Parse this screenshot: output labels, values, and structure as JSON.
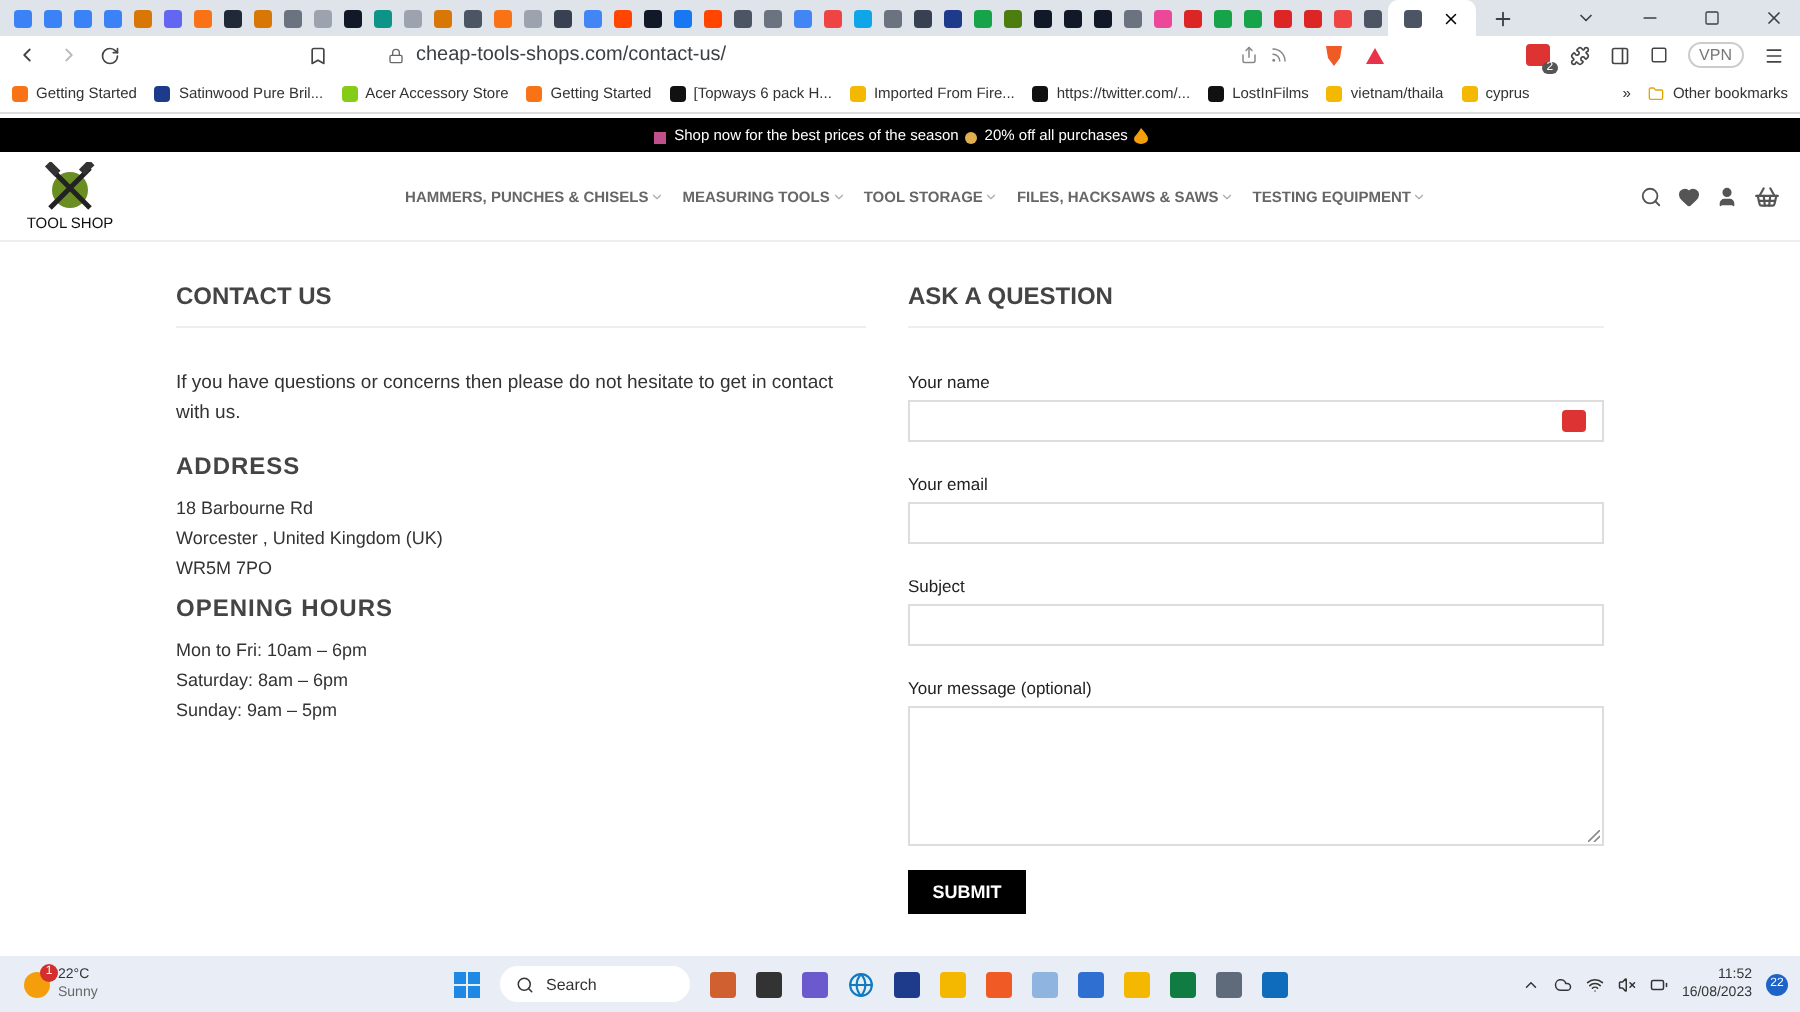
{
  "browser": {
    "tabs": [
      {
        "color": "#3b82f6",
        "selected": false
      },
      {
        "color": "#3b82f6",
        "selected": false
      },
      {
        "color": "#3b82f6",
        "selected": false
      },
      {
        "color": "#3b82f6",
        "selected": false
      },
      {
        "color": "#d97706",
        "selected": false
      },
      {
        "color": "#6366f1",
        "selected": false
      },
      {
        "color": "#f97316",
        "selected": false
      },
      {
        "color": "#1f2937",
        "selected": false
      },
      {
        "color": "#d97706",
        "selected": false
      },
      {
        "color": "#6b7280",
        "selected": false
      },
      {
        "color": "#9ca3af",
        "selected": false
      },
      {
        "color": "#111827",
        "selected": false
      },
      {
        "color": "#0d9488",
        "selected": false
      },
      {
        "color": "#9ca3af",
        "selected": false
      },
      {
        "color": "#d97706",
        "selected": false
      },
      {
        "color": "#4b5563",
        "selected": false
      },
      {
        "color": "#f97316",
        "selected": false
      },
      {
        "color": "#9ca3af",
        "selected": false
      },
      {
        "color": "#374151",
        "selected": false
      },
      {
        "color": "#4285f4",
        "selected": false
      },
      {
        "color": "#ff4500",
        "selected": false
      },
      {
        "color": "#111827",
        "selected": false
      },
      {
        "color": "#1877f2",
        "selected": false
      },
      {
        "color": "#ff4500",
        "selected": false
      },
      {
        "color": "#4b5563",
        "selected": false
      },
      {
        "color": "#6b7280",
        "selected": false
      },
      {
        "color": "#4285f4",
        "selected": false
      },
      {
        "color": "#ef4444",
        "selected": false
      },
      {
        "color": "#0ea5e9",
        "selected": false
      },
      {
        "color": "#6b7280",
        "selected": false
      },
      {
        "color": "#374151",
        "selected": false
      },
      {
        "color": "#1e3a8a",
        "selected": false
      },
      {
        "color": "#16a34a",
        "selected": false
      },
      {
        "color": "#4d7c0f",
        "selected": false
      },
      {
        "color": "#111827",
        "selected": false
      },
      {
        "color": "#111827",
        "selected": false
      },
      {
        "color": "#111827",
        "selected": false
      },
      {
        "color": "#6b7280",
        "selected": false
      },
      {
        "color": "#ec4899",
        "selected": false
      },
      {
        "color": "#dc2626",
        "selected": false
      },
      {
        "color": "#16a34a",
        "selected": false
      },
      {
        "color": "#16a34a",
        "selected": false
      },
      {
        "color": "#dc2626",
        "selected": false
      },
      {
        "color": "#dc2626",
        "selected": false
      },
      {
        "color": "#ef4444",
        "selected": false
      },
      {
        "color": "#4b5563",
        "selected": false
      },
      {
        "color": "#4b5563",
        "selected": true
      }
    ],
    "url": "cheap-tools-shops.com/contact-us/",
    "vpn": "VPN",
    "extension_badge": "2",
    "bookmarks": [
      "Getting Started",
      "Satinwood Pure Bril...",
      "Acer Accessory Store",
      "Getting Started",
      "[Topways 6 pack H...",
      "Imported From Fire...",
      "https://twitter.com/...",
      "LostInFilms",
      "vietnam/thaila",
      "cyprus"
    ],
    "bookmarks_more": "»",
    "other_bookmarks": "Other bookmarks"
  },
  "site": {
    "banner": [
      "Shop now for the best prices of the season",
      "20% off all purchases"
    ],
    "logo": "TOOL SHOP",
    "nav": [
      "HAMMERS, PUNCHES & CHISELS",
      "MEASURING TOOLS",
      "TOOL STORAGE",
      "FILES, HACKSAWS & SAWS",
      "TESTING EQUIPMENT"
    ]
  },
  "contact": {
    "title": "CONTACT US",
    "intro": "If you have questions or concerns then please do not hesitate to get in contact with us.",
    "sections": [
      {
        "heading": "ADDRESS",
        "lines": [
          "18 Barbourne Rd",
          "Worcester , United Kingdom (UK)",
          "WR5M 7PO"
        ]
      },
      {
        "heading": "OPENING HOURS",
        "lines": [
          "Mon to Fri: 10am – 6pm",
          "Saturday: 8am – 6pm",
          "Sunday: 9am – 5pm"
        ]
      }
    ]
  },
  "form": {
    "title": "ASK A QUESTION",
    "fields": [
      {
        "label": "Your name",
        "kind": "input"
      },
      {
        "label": "Your email",
        "kind": "input"
      },
      {
        "label": "Subject",
        "kind": "input"
      },
      {
        "label": "Your message (optional)",
        "kind": "textarea"
      }
    ],
    "submit": "SUBMIT"
  },
  "taskbar": {
    "weather": {
      "badge": "1",
      "temp": "22°C",
      "condition": "Sunny"
    },
    "search": "Search",
    "time": "11:52",
    "date": "16/08/2023",
    "notifications": "22"
  }
}
